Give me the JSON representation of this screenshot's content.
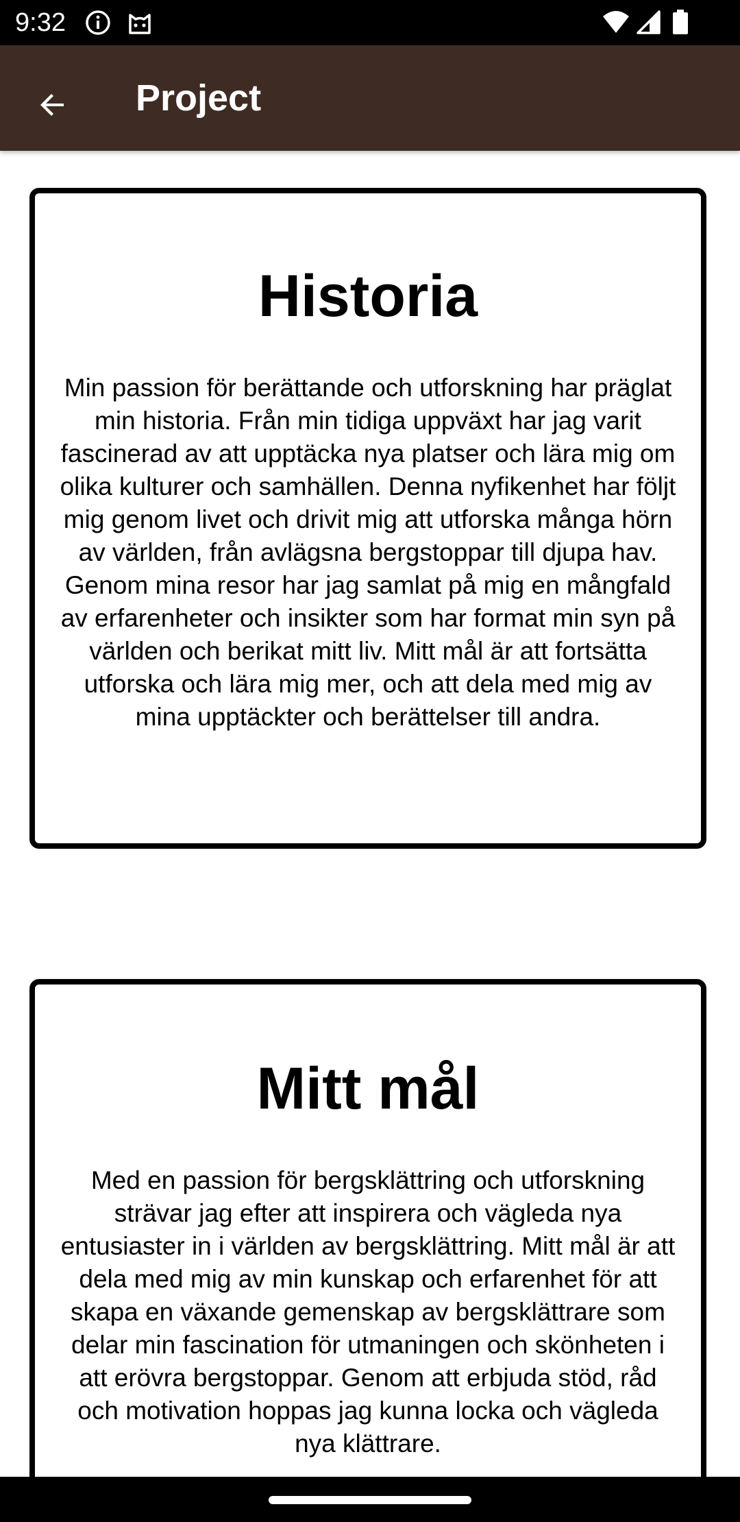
{
  "status_bar": {
    "time": "9:32",
    "left_icons": [
      "info-icon",
      "cat-face-icon"
    ],
    "right_icons": [
      "wifi-icon",
      "signal-icon",
      "battery-icon"
    ]
  },
  "app_bar": {
    "back_icon": "arrow-left-icon",
    "title": "Project"
  },
  "cards": [
    {
      "title": "Historia",
      "body": "Min passion för berättande och utforskning har präglat min historia. Från min tidiga uppväxt har jag varit fascinerad av att upptäcka nya platser och lära mig om olika kulturer och samhällen. Denna nyfikenhet har följt mig genom livet och drivit mig att utforska många hörn av världen, från avlägsna bergstoppar till djupa hav. Genom mina resor har jag samlat på mig en mångfald av erfarenheter och insikter som har format min syn på världen och berikat mitt liv. Mitt mål är att fortsätta utforska och lära mig mer, och att dela med mig av mina upptäckter och berättelser till andra."
    },
    {
      "title": "Mitt mål",
      "body": "Med en passion för bergsklättring och utforskning strävar jag efter att inspirera och vägleda nya entusiaster in i världen av bergsklättring. Mitt mål är att dela med mig av min kunskap och erfarenhet för att skapa en växande gemenskap av bergsklättrare som delar min fascination för utmaningen och skönheten i att erövra bergstoppar. Genom att erbjuda stöd, råd och motivation hoppas jag kunna locka och vägleda nya klättrare."
    }
  ],
  "colors": {
    "app_bar": "#3e2b24",
    "system_bars": "#000000",
    "card_border": "#000000",
    "background": "#ffffff"
  }
}
